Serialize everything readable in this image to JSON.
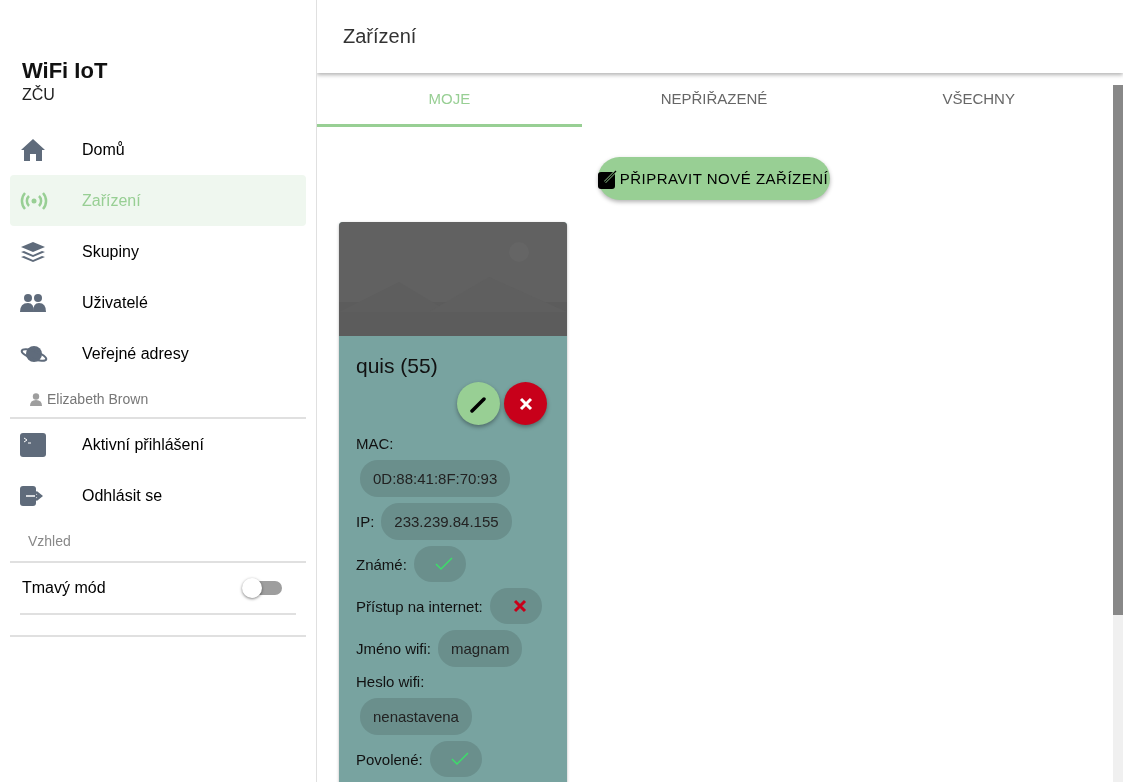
{
  "app": {
    "title": "WiFi IoT",
    "subtitle": "ZČU"
  },
  "nav": [
    {
      "label": "Domů",
      "selected": false
    },
    {
      "label": "Zařízení",
      "selected": true
    },
    {
      "label": "Skupiny",
      "selected": false
    },
    {
      "label": "Uživatelé",
      "selected": false
    },
    {
      "label": "Veřejné adresy",
      "selected": false
    }
  ],
  "user": {
    "name": "Elizabeth Brown"
  },
  "user_nav": [
    {
      "label": "Aktivní přihlášení"
    },
    {
      "label": "Odhlásit se"
    }
  ],
  "appearance": {
    "heading": "Vzhled",
    "dark_mode": {
      "label": "Tmavý mód",
      "on": false
    }
  },
  "page": {
    "title": "Zařízení"
  },
  "tabs": [
    {
      "label": "MOJE",
      "selected": true
    },
    {
      "label": "NEPŘIŘAZENÉ",
      "selected": false
    },
    {
      "label": "VŠECHNY",
      "selected": false
    }
  ],
  "new_button": "PŘIPRAVIT NOVÉ ZAŘÍZENÍ",
  "device": {
    "name": "quis (55)",
    "fields": [
      {
        "kind": "stacked",
        "label": "MAC:",
        "value": "0D:88:41:8F:70:93"
      },
      {
        "kind": "inline",
        "label": "IP:",
        "value": "233.239.84.155"
      },
      {
        "kind": "flag",
        "label": "Známé:",
        "on": true
      },
      {
        "kind": "flag",
        "label": "Přístup na internet:",
        "on": false
      },
      {
        "kind": "inline",
        "label": "Jméno wifi:",
        "value": "magnam"
      },
      {
        "kind": "stacked",
        "label": "Heslo wifi:",
        "value": "nenastavena"
      },
      {
        "kind": "flag",
        "label": "Povolené:",
        "on": true
      }
    ]
  }
}
